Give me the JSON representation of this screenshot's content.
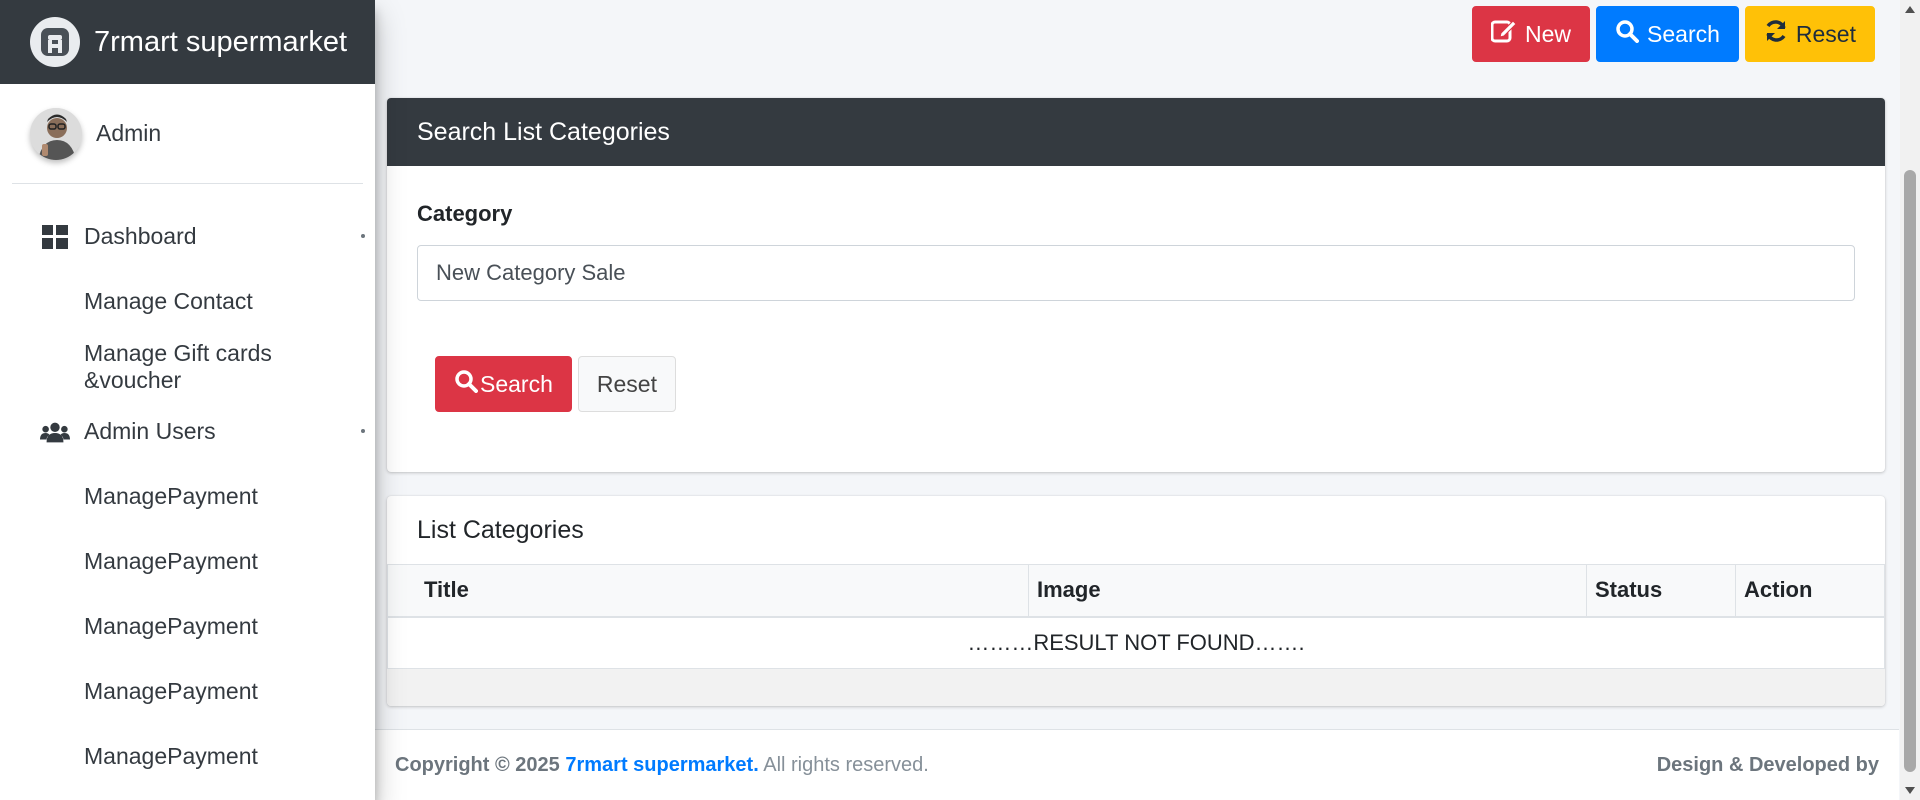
{
  "brand": {
    "name": "7rmart supermarket",
    "logo_icon": "adminlte-logo-icon"
  },
  "user": {
    "name": "Admin"
  },
  "sidebar": {
    "items": [
      {
        "label": "Dashboard",
        "icon": "grid-icon",
        "has_caret": true
      },
      {
        "label": "Manage Contact"
      },
      {
        "label": "Manage Gift cards &voucher"
      },
      {
        "label": "Admin Users",
        "icon": "users-icon",
        "has_caret": true
      },
      {
        "label": "ManagePayment"
      },
      {
        "label": "ManagePayment"
      },
      {
        "label": "ManagePayment"
      },
      {
        "label": "ManagePayment"
      },
      {
        "label": "ManagePayment"
      }
    ]
  },
  "toolbar": {
    "new_label": "New",
    "search_label": "Search",
    "reset_label": "Reset"
  },
  "search_card": {
    "title": "Search List Categories",
    "field_label": "Category",
    "field_value": "New Category Sale",
    "search_button": "Search",
    "reset_button": "Reset"
  },
  "list_card": {
    "title": "List Categories",
    "columns": [
      "Title",
      "Image",
      "Status",
      "Action"
    ],
    "empty_message": "………RESULT NOT FOUND……."
  },
  "footer": {
    "copyright_prefix": "Copyright © 2025",
    "brand_link": "7rmart supermarket.",
    "rights": "All rights reserved.",
    "right_text": "Design & Developed by"
  },
  "colors": {
    "danger": "#dc3545",
    "primary": "#007bff",
    "warning": "#ffc107",
    "dark": "#343a40"
  }
}
